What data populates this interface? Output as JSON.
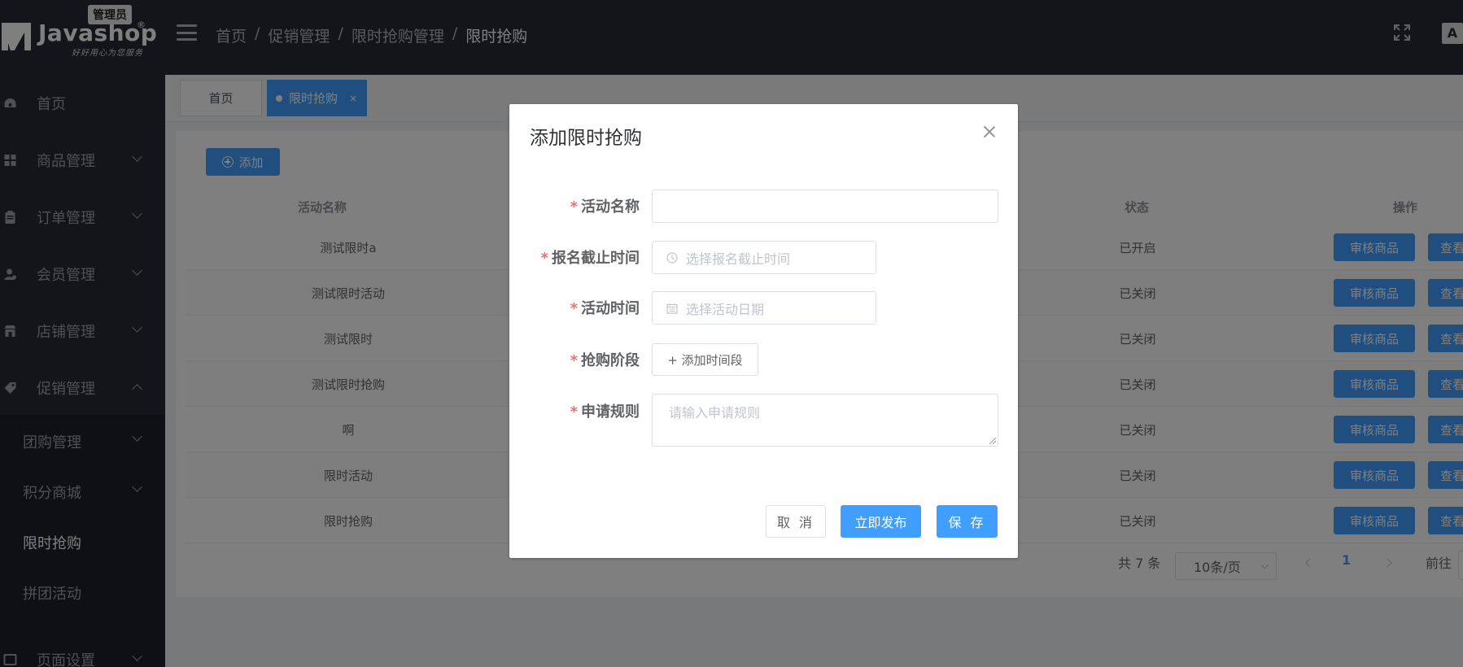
{
  "header": {
    "logo_text": "Javashop",
    "logo_reg": "®",
    "logo_slogan": "好好用心为您服务",
    "role_badge": "管理员",
    "breadcrumb": [
      "首页",
      "促销管理",
      "限时抢购管理",
      "限时抢购"
    ],
    "breadcrumb_sep": "/",
    "lang_icon_text": "A文"
  },
  "sidebar": {
    "items": [
      {
        "label": "首页",
        "icon": "dashboard-icon"
      },
      {
        "label": "商品管理",
        "icon": "grid-icon"
      },
      {
        "label": "订单管理",
        "icon": "clipboard-icon"
      },
      {
        "label": "会员管理",
        "icon": "user-icon"
      },
      {
        "label": "店铺管理",
        "icon": "store-icon"
      },
      {
        "label": "促销管理",
        "icon": "tag-icon"
      }
    ],
    "sub_items": [
      {
        "label": "团购管理"
      },
      {
        "label": "积分商城"
      },
      {
        "label": "限时抢购"
      },
      {
        "label": "拼团活动"
      }
    ],
    "bottom_item": "页面设置"
  },
  "tabs": [
    {
      "label": "首页"
    },
    {
      "label": "限时抢购",
      "close": "×"
    }
  ],
  "toolbar": {
    "add_label": "添加"
  },
  "table": {
    "headers": {
      "name": "活动名称",
      "status": "状态",
      "actions": "操作"
    },
    "rows": [
      {
        "name": "测试限时a",
        "status": "已开启"
      },
      {
        "name": "测试限时活动",
        "status": "已关闭"
      },
      {
        "name": "测试限时",
        "status": "已关闭"
      },
      {
        "name": "测试限时抢购",
        "status": "已关闭"
      },
      {
        "name": "啊",
        "status": "已关闭"
      },
      {
        "name": "限时活动",
        "status": "已关闭"
      },
      {
        "name": "限时抢购",
        "status": "已关闭"
      }
    ],
    "review_label": "审核商品",
    "view_label": "查看商品"
  },
  "pagination": {
    "total": "共 7 条",
    "page_size": "10条/页",
    "current_page": "1",
    "goto_label": "前往"
  },
  "dialog": {
    "title": "添加限时抢购",
    "fields": {
      "name_label": "活动名称",
      "deadline_label": "报名截止时间",
      "deadline_placeholder": "选择报名截止时间",
      "date_label": "活动时间",
      "date_placeholder": "选择活动日期",
      "stage_label": "抢购阶段",
      "stage_button": "+ 添加时间段",
      "rules_label": "申请规则",
      "rules_placeholder": "请输入申请规则"
    },
    "buttons": {
      "cancel": "取 消",
      "publish": "立即发布",
      "save": "保 存"
    }
  },
  "colors": {
    "primary": "#409eff",
    "header_bg": "#282937",
    "required": "#f56c6c"
  }
}
